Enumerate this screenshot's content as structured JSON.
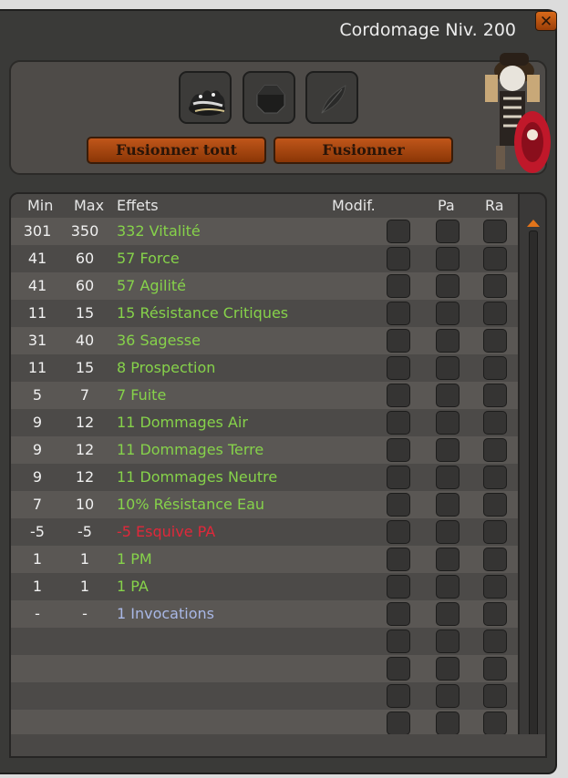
{
  "window": {
    "title": "Cordomage Niv. 200",
    "close_label": "✕"
  },
  "slots": [
    {
      "name": "boots-item-slot",
      "icon": "boots-icon"
    },
    {
      "name": "rune-slot",
      "icon": "hexagon-icon"
    },
    {
      "name": "feather-slot",
      "icon": "feather-icon"
    }
  ],
  "buttons": {
    "merge_all": "Fusionner tout",
    "merge": "Fusionner"
  },
  "table": {
    "headers": {
      "min": "Min",
      "max": "Max",
      "effects": "Effets",
      "modif": "Modif.",
      "pa": "Pa",
      "ra": "Ra"
    },
    "rows": [
      {
        "min": "301",
        "max": "350",
        "effect": "332 Vitalité",
        "color": "green"
      },
      {
        "min": "41",
        "max": "60",
        "effect": "57 Force",
        "color": "green"
      },
      {
        "min": "41",
        "max": "60",
        "effect": "57 Agilité",
        "color": "green"
      },
      {
        "min": "11",
        "max": "15",
        "effect": "15 Résistance Critiques",
        "color": "green"
      },
      {
        "min": "31",
        "max": "40",
        "effect": "36 Sagesse",
        "color": "green"
      },
      {
        "min": "11",
        "max": "15",
        "effect": "8 Prospection",
        "color": "green"
      },
      {
        "min": "5",
        "max": "7",
        "effect": "7 Fuite",
        "color": "green"
      },
      {
        "min": "9",
        "max": "12",
        "effect": "11 Dommages Air",
        "color": "green"
      },
      {
        "min": "9",
        "max": "12",
        "effect": "11 Dommages Terre",
        "color": "green"
      },
      {
        "min": "9",
        "max": "12",
        "effect": "11 Dommages Neutre",
        "color": "green"
      },
      {
        "min": "7",
        "max": "10",
        "effect": "10% Résistance Eau",
        "color": "green"
      },
      {
        "min": "-5",
        "max": "-5",
        "effect": "-5 Esquive PA",
        "color": "red"
      },
      {
        "min": "1",
        "max": "1",
        "effect": "1 PM",
        "color": "green"
      },
      {
        "min": "1",
        "max": "1",
        "effect": "1 PA",
        "color": "green"
      },
      {
        "min": "-",
        "max": "-",
        "effect": "1 Invocations",
        "color": "blue"
      },
      {
        "min": "",
        "max": "",
        "effect": "",
        "color": "green"
      },
      {
        "min": "",
        "max": "",
        "effect": "",
        "color": "green"
      },
      {
        "min": "",
        "max": "",
        "effect": "",
        "color": "green"
      },
      {
        "min": "",
        "max": "",
        "effect": "",
        "color": "green"
      }
    ]
  },
  "colors": {
    "green": "#86d24a",
    "red": "#e0283a",
    "blue": "#a9b8e6",
    "accent": "#e2741a"
  }
}
